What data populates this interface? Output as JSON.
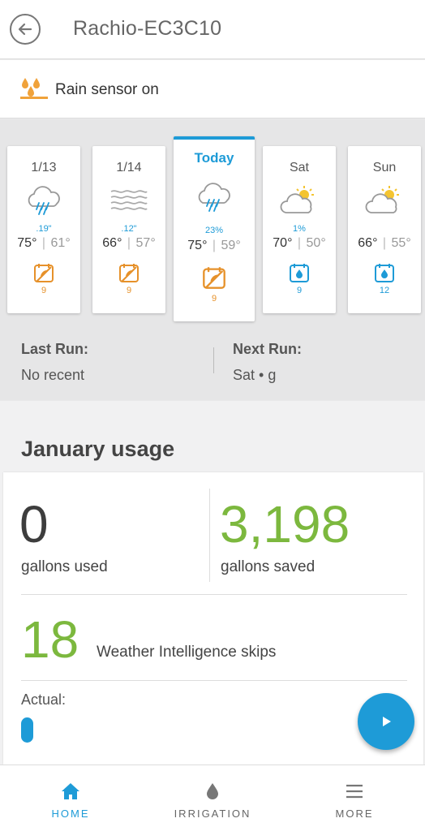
{
  "header": {
    "title": "Rachio-EC3C10",
    "back_icon": "back-arrow-icon"
  },
  "rain_sensor": {
    "text": "Rain sensor on",
    "icon": "rain-sensor-icon",
    "color": "#f0a23a"
  },
  "forecast": [
    {
      "label": "1/13",
      "icon": "rain-cloud-icon",
      "precip": ".19\"",
      "high": "75°",
      "low": "61°",
      "schedule_icon": "skip-calendar-icon",
      "count": "9",
      "status": "skip"
    },
    {
      "label": "1/14",
      "icon": "fog-icon",
      "precip": ".12\"",
      "high": "66°",
      "low": "57°",
      "schedule_icon": "skip-calendar-icon",
      "count": "9",
      "status": "skip"
    },
    {
      "label": "Today",
      "icon": "rain-cloud-icon",
      "precip": "23%",
      "high": "75°",
      "low": "59°",
      "schedule_icon": "skip-calendar-icon",
      "count": "9",
      "status": "skip"
    },
    {
      "label": "Sat",
      "icon": "partly-cloudy-icon",
      "precip": "1%",
      "high": "70°",
      "low": "50°",
      "schedule_icon": "water-drop-calendar-icon",
      "count": "9",
      "status": "water"
    },
    {
      "label": "Sun",
      "icon": "partly-cloudy-icon",
      "precip": "",
      "high": "66°",
      "low": "55°",
      "schedule_icon": "water-drop-calendar-icon",
      "count": "12",
      "status": "water"
    }
  ],
  "runs": {
    "last_label": "Last Run:",
    "last_value": "No recent",
    "next_label": "Next Run:",
    "next_value": "Sat • g"
  },
  "usage": {
    "title": "January usage",
    "gallons_used": "0",
    "gallons_used_label": "gallons used",
    "gallons_saved": "3,198",
    "gallons_saved_label": "gallons saved",
    "skips": "18",
    "skips_label": "Weather Intelligence skips",
    "actual_label": "Actual:"
  },
  "nav": {
    "items": [
      {
        "label": "HOME",
        "icon": "home-icon"
      },
      {
        "label": "IRRIGATION",
        "icon": "drop-icon"
      },
      {
        "label": "MORE",
        "icon": "menu-icon"
      }
    ]
  },
  "colors": {
    "accent": "#1e9bd7",
    "green": "#7cb83e",
    "orange": "#e6912a"
  }
}
